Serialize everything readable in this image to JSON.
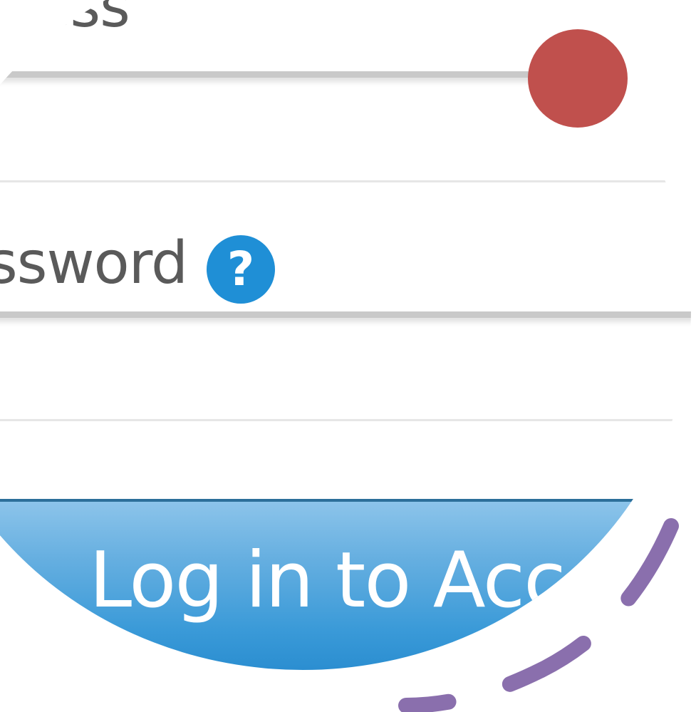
{
  "form": {
    "email_label": "ress",
    "password_label": "ssword",
    "help_icon_glyph": "?",
    "login_button_label": "Log in to Acco"
  },
  "colors": {
    "accent_blue": "#1f8fd6",
    "button_blue": "#3a9ad8",
    "record_dot": "#c0504d",
    "dashed_arc": "#8a6fad"
  },
  "icons": {
    "help": "question-circle-icon",
    "record": "record-dot-icon"
  }
}
